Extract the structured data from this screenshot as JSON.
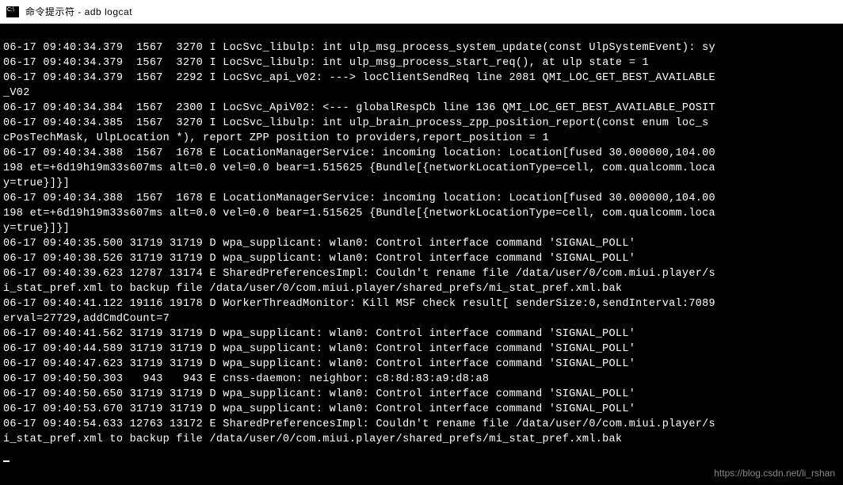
{
  "window": {
    "title": "命令提示符 - adb  logcat"
  },
  "log_lines": [
    "06-17 09:40:34.379  1567  3270 I LocSvc_libulp: int ulp_msg_process_system_update(const UlpSystemEvent): sy",
    "06-17 09:40:34.379  1567  3270 I LocSvc_libulp: int ulp_msg_process_start_req(), at ulp state = 1",
    "06-17 09:40:34.379  1567  2292 I LocSvc_api_v02: ---> locClientSendReq line 2081 QMI_LOC_GET_BEST_AVAILABLE",
    "_V02",
    "06-17 09:40:34.384  1567  2300 I LocSvc_ApiV02: <--- globalRespCb line 136 QMI_LOC_GET_BEST_AVAILABLE_POSIT",
    "06-17 09:40:34.385  1567  3270 I LocSvc_libulp: int ulp_brain_process_zpp_position_report(const enum loc_s",
    "cPosTechMask, UlpLocation *), report ZPP position to providers,report_position = 1",
    "06-17 09:40:34.388  1567  1678 E LocationManagerService: incoming location: Location[fused 30.000000,104.00",
    "198 et=+6d19h19m33s607ms alt=0.0 vel=0.0 bear=1.515625 {Bundle[{networkLocationType=cell, com.qualcomm.loca",
    "y=true}]}]",
    "06-17 09:40:34.388  1567  1678 E LocationManagerService: incoming location: Location[fused 30.000000,104.00",
    "198 et=+6d19h19m33s607ms alt=0.0 vel=0.0 bear=1.515625 {Bundle[{networkLocationType=cell, com.qualcomm.loca",
    "y=true}]}]",
    "06-17 09:40:35.500 31719 31719 D wpa_supplicant: wlan0: Control interface command 'SIGNAL_POLL'",
    "06-17 09:40:38.526 31719 31719 D wpa_supplicant: wlan0: Control interface command 'SIGNAL_POLL'",
    "06-17 09:40:39.623 12787 13174 E SharedPreferencesImpl: Couldn't rename file /data/user/0/com.miui.player/s",
    "i_stat_pref.xml to backup file /data/user/0/com.miui.player/shared_prefs/mi_stat_pref.xml.bak",
    "06-17 09:40:41.122 19116 19178 D WorkerThreadMonitor: Kill MSF check result[ senderSize:0,sendInterval:7089",
    "erval=27729,addCmdCount=7",
    "06-17 09:40:41.562 31719 31719 D wpa_supplicant: wlan0: Control interface command 'SIGNAL_POLL'",
    "06-17 09:40:44.589 31719 31719 D wpa_supplicant: wlan0: Control interface command 'SIGNAL_POLL'",
    "06-17 09:40:47.623 31719 31719 D wpa_supplicant: wlan0: Control interface command 'SIGNAL_POLL'",
    "06-17 09:40:50.303   943   943 E cnss-daemon: neighbor: c8:8d:83:a9:d8:a8",
    "06-17 09:40:50.650 31719 31719 D wpa_supplicant: wlan0: Control interface command 'SIGNAL_POLL'",
    "06-17 09:40:53.670 31719 31719 D wpa_supplicant: wlan0: Control interface command 'SIGNAL_POLL'",
    "06-17 09:40:54.633 12763 13172 E SharedPreferencesImpl: Couldn't rename file /data/user/0/com.miui.player/s",
    "i_stat_pref.xml to backup file /data/user/0/com.miui.player/shared_prefs/mi_stat_pref.xml.bak"
  ],
  "watermark": "https://blog.csdn.net/li_rshan"
}
